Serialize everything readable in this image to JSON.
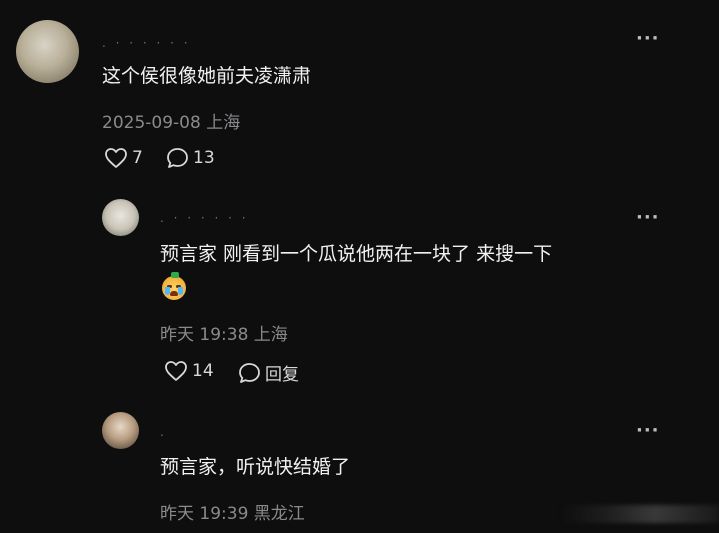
{
  "comments": [
    {
      "username": ". · · · · · ·",
      "text": "这个侯很像她前夫凌潇肃",
      "meta": "2025-09-08 上海",
      "likes": "7",
      "replies_count": "13"
    }
  ],
  "replies": [
    {
      "username": ". · · · · · ·",
      "text": "预言家 刚看到一个瓜说他两在一块了 来搜一下",
      "emoji": "crying-emoji-icon",
      "meta": "昨天 19:38 上海",
      "likes": "14",
      "reply_label": "回复"
    },
    {
      "username": ".",
      "text": "预言家，听说快结婚了",
      "meta": "昨天 19:39 黑龙江"
    }
  ],
  "more_label": "···"
}
